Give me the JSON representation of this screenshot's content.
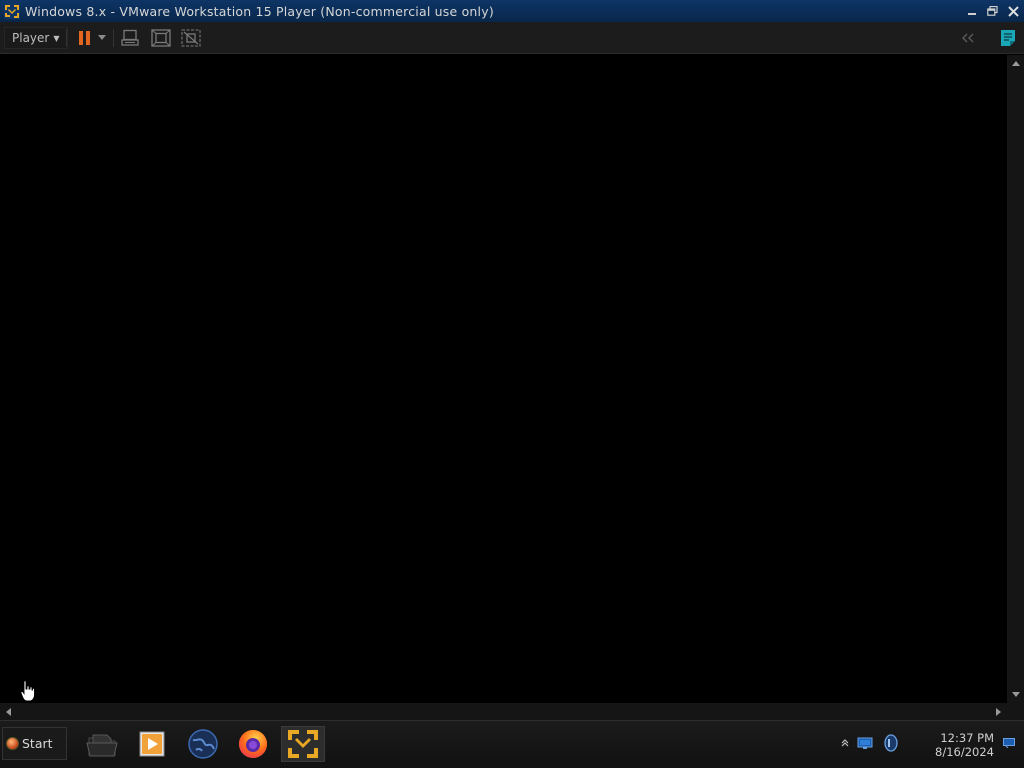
{
  "window": {
    "title": "Windows 8.x - VMware Workstation 15 Player (Non-commercial use only)",
    "controls": [
      "minimize-icon",
      "restore-icon",
      "close-icon"
    ]
  },
  "toolbar": {
    "player_menu_label": "Player",
    "buttons": [
      "pause-icon",
      "dropdown-caret-icon",
      "send-ctrl-alt-del-icon",
      "fit-guest-icon",
      "unity-icon"
    ],
    "right_buttons": [
      "collapse-icon",
      "notes-icon"
    ]
  },
  "colors": {
    "titlebar": "#0e3566",
    "pause_accent": "#e2661f",
    "vmware_yellow": "#e8a823",
    "notes_teal": "#1aa8b8"
  },
  "taskbar": {
    "start_label": "Start",
    "apps": [
      "file-explorer-icon",
      "media-player-icon",
      "browser-globe-icon",
      "firefox-icon",
      "vmware-player-icon"
    ],
    "tray": [
      "show-hidden-icons-chevron",
      "network-icon",
      "volume-icon"
    ],
    "clock_time": "12:37 PM",
    "clock_date": "8/16/2024"
  }
}
